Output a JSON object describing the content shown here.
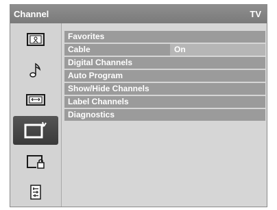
{
  "header": {
    "title": "Channel",
    "right_label": "TV"
  },
  "sidebar": {
    "items": [
      {
        "icon": "picture-icon"
      },
      {
        "icon": "music-note-icon"
      },
      {
        "icon": "screen-settings-icon"
      },
      {
        "icon": "channel-tv-icon",
        "selected": true
      },
      {
        "icon": "lock-icon"
      },
      {
        "icon": "list-icon"
      }
    ]
  },
  "menu": {
    "items": [
      {
        "label": "Favorites"
      },
      {
        "label": "Cable",
        "value": "On"
      },
      {
        "label": "Digital Channels"
      },
      {
        "label": "Auto Program"
      },
      {
        "label": "Show/Hide Channels"
      },
      {
        "label": "Label Channels"
      },
      {
        "label": "Diagnostics"
      }
    ]
  },
  "colors": {
    "titlebar": "#858585",
    "row": "#9b9b9b",
    "value_cell": "#b6b6b6",
    "selected_icon_bg": "#444444"
  }
}
